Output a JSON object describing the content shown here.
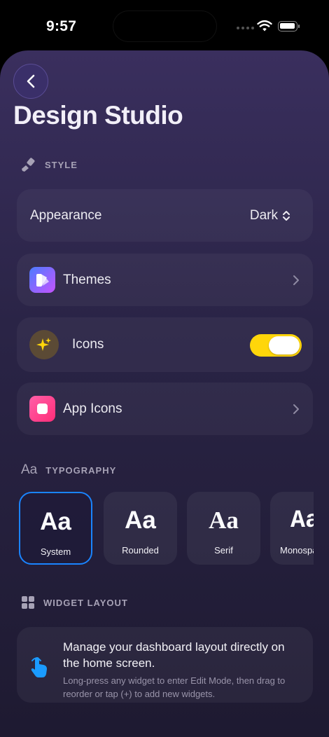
{
  "status_bar": {
    "time": "9:57"
  },
  "header": {
    "title": "Design Studio"
  },
  "sections": {
    "style": "STYLE",
    "typography": "TYPOGRAPHY",
    "typography_glyph": "Aa",
    "widget_layout": "WIDGET LAYOUT"
  },
  "style_rows": {
    "appearance": {
      "label": "Appearance",
      "value": "Dark"
    },
    "themes": {
      "label": "Themes"
    },
    "icons": {
      "label": "Icons",
      "toggle_on": true
    },
    "app_icons": {
      "label": "App Icons"
    }
  },
  "typography": {
    "fonts": [
      {
        "sample": "Aa",
        "name": "System",
        "selected": true
      },
      {
        "sample": "Aa",
        "name": "Rounded",
        "selected": false
      },
      {
        "sample": "Aa",
        "name": "Serif",
        "selected": false
      },
      {
        "sample": "Aa",
        "name": "Monospaced",
        "selected": false
      }
    ]
  },
  "widget_layout": {
    "title": "Manage your dashboard layout directly on the home screen.",
    "body": "Long-press any widget to enter Edit Mode, then drag to reorder or tap (+) to add new widgets."
  },
  "colors": {
    "toggle_on": "#ffd60a",
    "selection": "#1a84ff",
    "icons_badge": "#5b4a35"
  },
  "icon_names": {
    "style": "paintbrush-icon",
    "themes": "theme-palette-icon",
    "icons": "sparkles-icon",
    "app_icons": "app-square-icon",
    "widget_layout": "grid-icon",
    "info": "tap-hand-icon"
  }
}
